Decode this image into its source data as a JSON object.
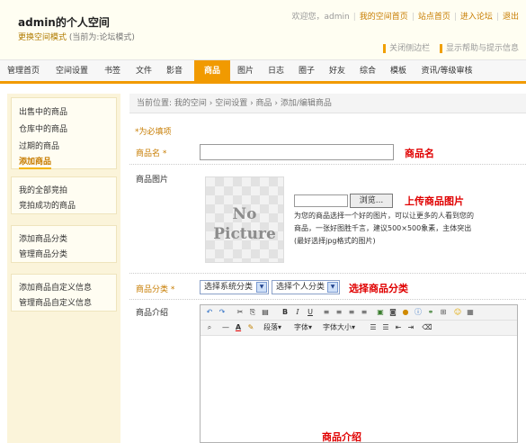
{
  "header": {
    "site_title": "admin的个人空间",
    "mode_link": "更换空间模式",
    "mode_current": "(当前为:论坛模式)",
    "welcome": "欢迎您，admin",
    "links": [
      "我的空间首页",
      "站点首页",
      "进入论坛",
      "退出"
    ],
    "tools": [
      "关闭侧边栏",
      "显示帮助与提示信息"
    ]
  },
  "nav": {
    "tabs": [
      "管理首页",
      "空间设置",
      "书签",
      "文件",
      "影音",
      "商品",
      "图片",
      "日志",
      "圈子",
      "好友",
      "综合",
      "模板",
      "资讯/等级审核"
    ],
    "active": "商品"
  },
  "sidebar": {
    "groups": [
      [
        "出售中的商品",
        "仓库中的商品",
        "过期的商品",
        "添加商品"
      ],
      [
        "我的全部竞拍",
        "竞拍成功的商品"
      ],
      [
        "添加商品分类",
        "管理商品分类"
      ],
      [
        "添加商品自定义信息",
        "管理商品自定义信息"
      ]
    ],
    "current": "添加商品"
  },
  "main": {
    "breadcrumb": "当前位置: 我的空间 › 空间设置 › 商品 › 添加/编辑商品",
    "required_note": "*为必填项",
    "name_label": "商品名 *",
    "name_value": "",
    "image_label": "商品图片",
    "placeholder_image_text": "No Picture",
    "browse_label": "浏览...",
    "image_hint": "为您的商品选择一个好的图片，可以让更多的人看到您的商品，一张好图胜千言，建议500×500象素，主体突出(最好选择jpg格式的图片)",
    "category_label": "商品分类 *",
    "system_category": "选择系统分类",
    "personal_category": "选择个人分类",
    "intro_label": "商品介绍",
    "toolbar_text": {
      "paragraph": "段落",
      "font": "字体",
      "font_size": "字体大小"
    }
  },
  "annotations": {
    "name": "商品名",
    "upload": "上传商品图片",
    "category": "选择商品分类",
    "intro": "商品介绍"
  },
  "icons": {
    "toolbar_row1": [
      "undo-icon",
      "redo-icon",
      "cut-icon",
      "copy-icon",
      "paste-icon",
      "bold-icon",
      "italic-icon",
      "underline-icon",
      "align-left-icon",
      "align-center-icon",
      "align-right-icon",
      "justify-icon",
      "image-icon",
      "media-icon",
      "flash-icon",
      "info-icon",
      "link-icon",
      "table-icon",
      "smiley-icon",
      "html-icon"
    ],
    "toolbar_row2": [
      "find-icon",
      "horizontal-rule-icon",
      "font-color-icon",
      "highlight-icon",
      "ordered-list-icon",
      "unordered-list-icon",
      "outdent-icon",
      "indent-icon",
      "clear-format-icon"
    ]
  },
  "colors": {
    "accent": "#f19a00",
    "link": "#c77c00",
    "annotation": "#e00000",
    "sidebar_bg": "#fbf4da"
  }
}
